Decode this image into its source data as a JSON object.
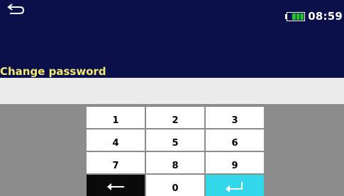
{
  "header": {
    "back_icon": "return-arrow-icon",
    "battery_icon": "battery-icon",
    "battery_level_percent": 70,
    "clock": "08:59",
    "title": "Change password"
  },
  "password_field": {
    "value": ""
  },
  "keypad": {
    "keys": [
      {
        "name": "key-1",
        "label": "1"
      },
      {
        "name": "key-2",
        "label": "2"
      },
      {
        "name": "key-3",
        "label": "3"
      },
      {
        "name": "key-4",
        "label": "4"
      },
      {
        "name": "key-5",
        "label": "5"
      },
      {
        "name": "key-6",
        "label": "6"
      },
      {
        "name": "key-7",
        "label": "7"
      },
      {
        "name": "key-8",
        "label": "8"
      },
      {
        "name": "key-9",
        "label": "9"
      },
      {
        "name": "key-backspace",
        "icon": "backspace-arrow-icon"
      },
      {
        "name": "key-0",
        "label": "0"
      },
      {
        "name": "key-enter",
        "icon": "enter-icon"
      }
    ]
  },
  "colors": {
    "header_bg": "#0b0f4a",
    "title_text": "#f2ea73",
    "battery_fill": "#22c433",
    "backspace_key": "#0a0a0a",
    "enter_key": "#33d7ea"
  }
}
